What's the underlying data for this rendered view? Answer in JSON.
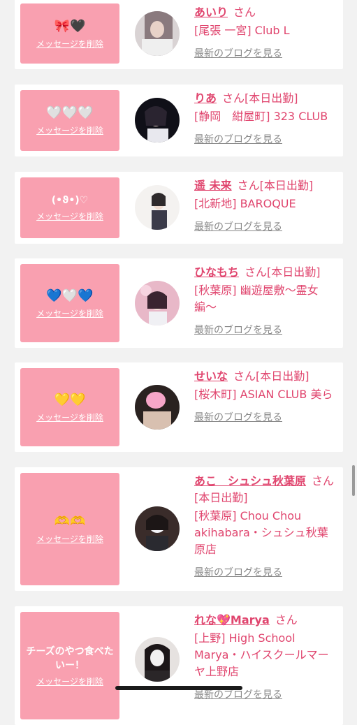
{
  "colors": {
    "accent": "#e0456e",
    "message_bg": "#f9a0b0",
    "link_gray": "#888888"
  },
  "cards": [
    {
      "emoji": "🎀🖤",
      "delete_label": "メッセージを削除",
      "name": "あいり",
      "honorific": "さん",
      "status": "",
      "shop": "[尾張 一宮] Club L",
      "blog_label": "最新のブログを見る"
    },
    {
      "emoji": "🤍🤍🤍",
      "delete_label": "メッセージを削除",
      "name": "りあ",
      "honorific": "さん",
      "status": "[本日出勤]",
      "shop": "[静岡　紺屋町] 323 CLUB",
      "blog_label": "最新のブログを見る"
    },
    {
      "emoji": "(•ϑ•)♡",
      "delete_label": "メッセージを削除",
      "name": "遥 未来",
      "honorific": "さん",
      "status": "[本日出勤]",
      "shop": "[北新地] BAROQUE",
      "blog_label": "最新のブログを見る"
    },
    {
      "emoji": "💙🤍💙",
      "delete_label": "メッセージを削除",
      "name": "ひなもち",
      "honorific": "さん",
      "status": "[本日出勤]",
      "shop": "[秋葉原] 幽遊屋敷〜霊女編〜",
      "blog_label": "最新のブログを見る"
    },
    {
      "emoji": "💛💛",
      "delete_label": "メッセージを削除",
      "name": "せいな",
      "honorific": "さん",
      "status": "[本日出勤]",
      "shop": "[桜木町] ASIAN CLUB 美ら",
      "blog_label": "最新のブログを見る"
    },
    {
      "emoji": "🫶🫶",
      "delete_label": "メッセージを削除",
      "name": "あこ　シュシュ秋葉原",
      "honorific": "さん",
      "status": "[本日出勤]",
      "shop": "[秋葉原] Chou Chou akihabara・シュシュ秋葉原店",
      "blog_label": "最新のブログを見る"
    },
    {
      "emoji": "チーズのやつ食べたいー！",
      "delete_label": "メッセージを削除",
      "name": "れな💖Marya",
      "honorific": "さん",
      "status": "",
      "shop": "[上野] High School Marya・ハイスクールマーヤ上野店",
      "blog_label": "最新のブログを見る"
    }
  ]
}
